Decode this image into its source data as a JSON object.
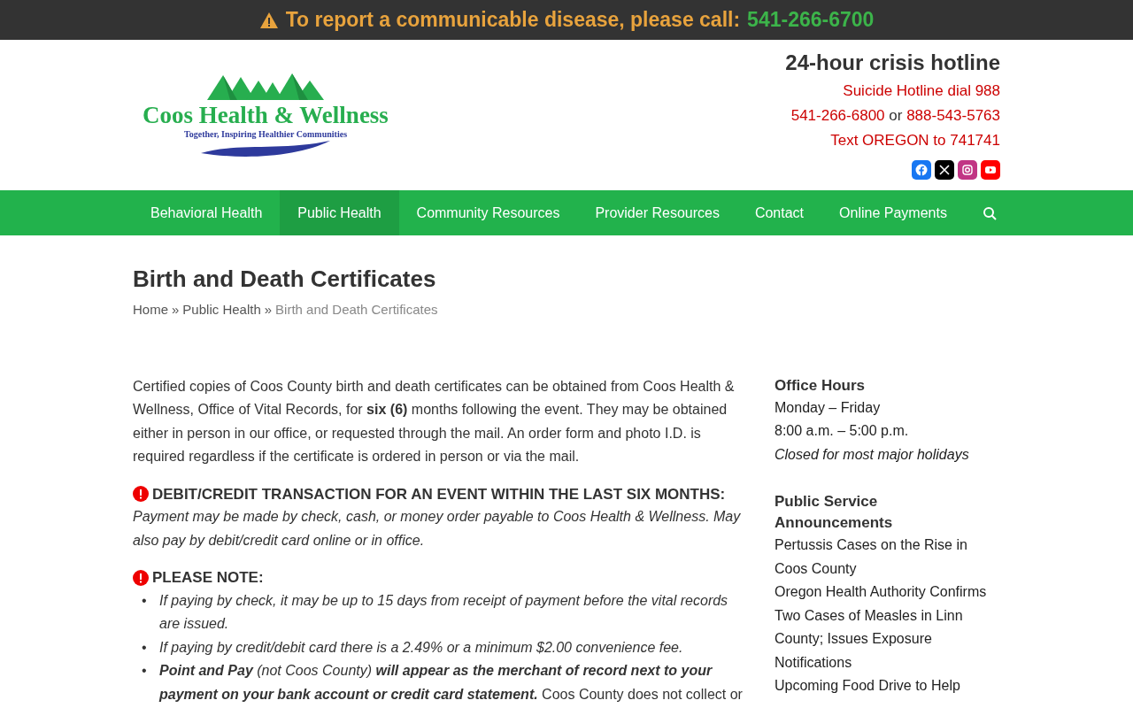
{
  "alert_bar": {
    "text": "To report a communicable disease, please call:",
    "phone": "541-266-6700"
  },
  "logo": {
    "name": "Coos Health & Wellness",
    "tagline": "Together, Inspiring Healthier Communities"
  },
  "hotline": {
    "title": "24-hour crisis hotline",
    "lines": [
      {
        "parts": [
          "Suicide Hotline dial 988"
        ]
      },
      {
        "parts": [
          "541-266-6800",
          " or ",
          "888-543-5763"
        ]
      },
      {
        "parts": [
          "Text OREGON to 741741"
        ]
      }
    ]
  },
  "social": [
    {
      "kind": "facebook",
      "color": "#1877f2"
    },
    {
      "kind": "x",
      "color": "#000000"
    },
    {
      "kind": "instagram",
      "color": "#c13584"
    },
    {
      "kind": "youtube",
      "color": "#ff0000"
    }
  ],
  "nav": [
    {
      "label": "Behavioral Health",
      "selected": false
    },
    {
      "label": "Public Health",
      "selected": true
    },
    {
      "label": "Community Resources",
      "selected": false
    },
    {
      "label": "Provider Resources",
      "selected": false
    },
    {
      "label": "Contact",
      "selected": false
    },
    {
      "label": "Online Payments",
      "selected": false
    }
  ],
  "page": {
    "title": "Birth and Death Certificates",
    "breadcrumb": [
      {
        "label": "Home",
        "current": false
      },
      {
        "label": "»",
        "kind": "separator"
      },
      {
        "label": "Public Health",
        "current": false
      },
      {
        "label": "»",
        "kind": "separator"
      },
      {
        "label": "Birth and Death Certificates",
        "current": true
      }
    ]
  },
  "content": [
    {
      "kind": "paragraph",
      "text": "Certified copies of Coos County birth and death certificates can be obtained from Coos Health & Wellness, Office of Vital Records, for **six (6)** months following the event. They may be obtained either in person in our office, or requested through the mail. An order form and photo I.D. is required regardless if the certificate is ordered in person or via the mail."
    },
    {
      "kind": "notice",
      "title": "DEBIT/CREDIT TRANSACTION FOR AN EVENT WITHIN THE LAST SIX MONTHS:",
      "text": "*Payment may be made by check, cash, or money order payable to Coos Health & Wellness. May also pay by debit/credit card online or in office.*"
    },
    {
      "kind": "notice",
      "title": "PLEASE NOTE:",
      "bullets": [
        {
          "marker": "•",
          "parts": [
            {
              "text": "If paying by check, it may be up to 15 days from receipt of payment before the vital records are issued.",
              "bold": false,
              "italic": true
            }
          ]
        },
        {
          "marker": "•",
          "parts": [
            {
              "text": "If paying by credit/debit card there is a 2.49% or a minimum $2.00 convenience fee.",
              "bold": false,
              "italic": true
            }
          ]
        },
        {
          "marker": "•",
          "parts": [
            {
              "text": "Point and Pay",
              "bold": true,
              "italic": true
            },
            {
              "text": " (not Coos County) ",
              "bold": false,
              "italic": true
            },
            {
              "text": "will appear as the merchant of record next to your payment on your bank account or credit card statement.",
              "bold": true,
              "italic": true
            },
            {
              "text": " Coos County does not collect or",
              "bold": false,
              "italic": false
            }
          ]
        }
      ]
    }
  ],
  "sidebar": {
    "office_hours": {
      "title": "Office Hours",
      "lines": [
        {
          "text": "Monday – Friday",
          "italic": false
        },
        {
          "text": "8:00 a.m. – 5:00 p.m.",
          "italic": false
        },
        {
          "text": "Closed for most major holidays",
          "italic": true
        }
      ]
    },
    "announcements": {
      "title": "Public Service Announcements",
      "items": [
        "Pertussis Cases on the Rise in Coos County",
        "Oregon Health Authority Confirms Two Cases of Measles in Linn County; Issues Exposure Notifications",
        "Upcoming Food Drive to Help"
      ]
    }
  }
}
